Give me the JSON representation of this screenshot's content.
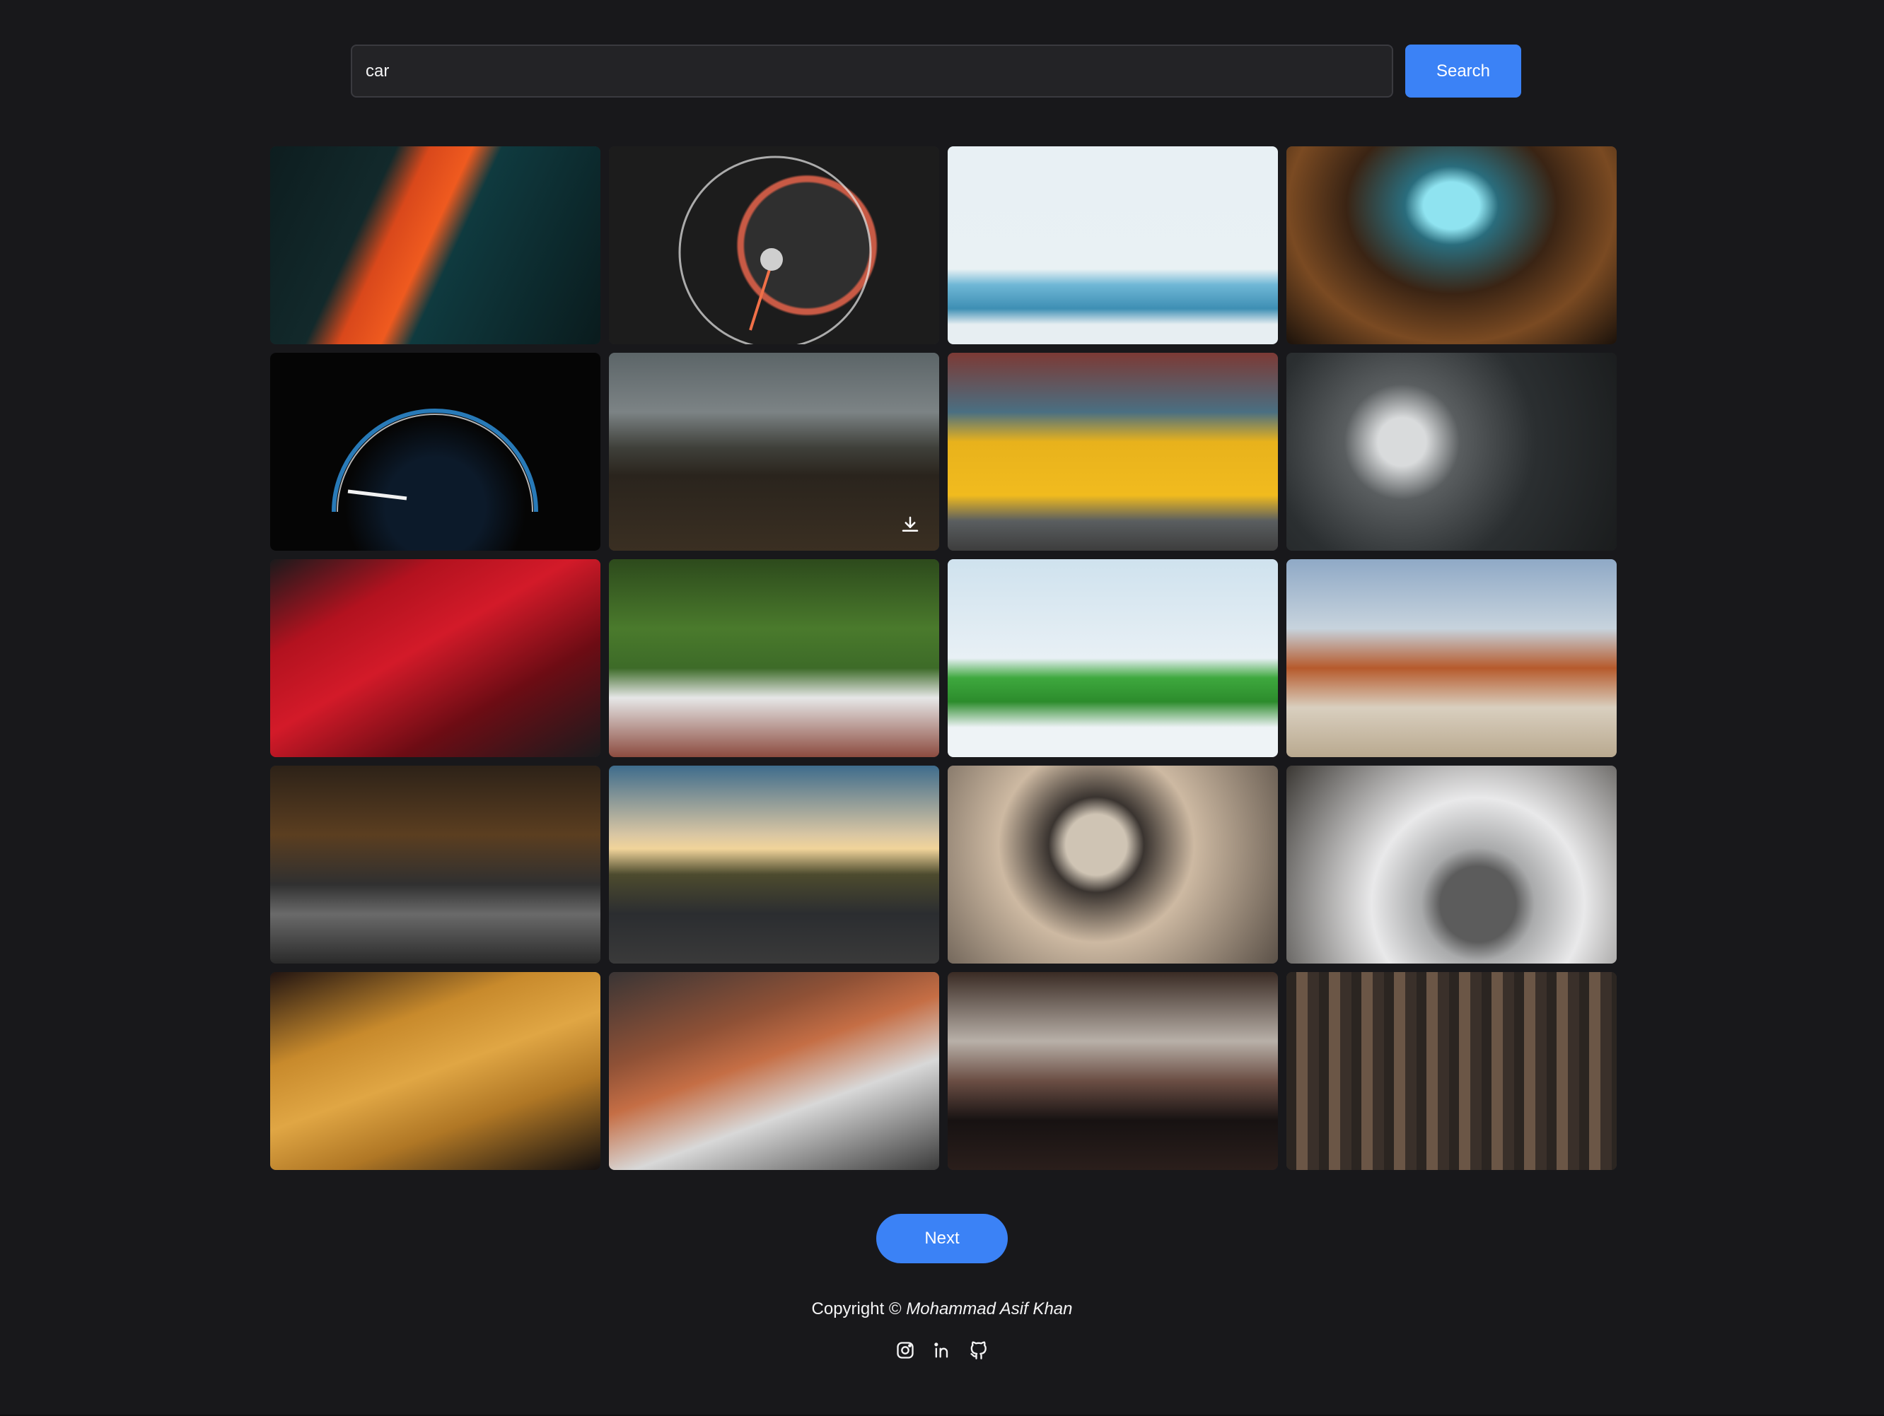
{
  "search": {
    "value": "car",
    "button_label": "Search"
  },
  "gallery": {
    "tiles": [
      {
        "name": "orange-car-closeup-photo"
      },
      {
        "name": "speedometer-photo"
      },
      {
        "name": "blue-car-roof-luggage-photo"
      },
      {
        "name": "car-interior-hyperspace-photo"
      },
      {
        "name": "tachometer-dark-photo"
      },
      {
        "name": "white-suv-landscape-photo"
      },
      {
        "name": "yellow-vintage-car-photo"
      },
      {
        "name": "truck-dashboard-photo"
      },
      {
        "name": "red-sports-car-photo"
      },
      {
        "name": "white-convertible-photo"
      },
      {
        "name": "green-monster-truck-photo"
      },
      {
        "name": "white-suv-desert-photo"
      },
      {
        "name": "black-suv-forest-road-photo"
      },
      {
        "name": "sports-car-sunset-road-photo"
      },
      {
        "name": "steering-wheel-interior-photo"
      },
      {
        "name": "white-car-wheel-photo"
      },
      {
        "name": "yellow-mercedes-concept-photo"
      },
      {
        "name": "rusty-vintage-car-photo"
      },
      {
        "name": "lamborghini-rear-photo"
      },
      {
        "name": "red-suv-pine-forest-photo"
      }
    ],
    "download_icon": "download-icon"
  },
  "pagination": {
    "next_label": "Next"
  },
  "footer": {
    "copyright_prefix": "Copyright ©",
    "author": "Mohammad Asif Khan",
    "socials": [
      "instagram-icon",
      "linkedin-icon",
      "github-icon"
    ]
  },
  "colors": {
    "background": "#18181b",
    "accent": "#3b82f6"
  }
}
